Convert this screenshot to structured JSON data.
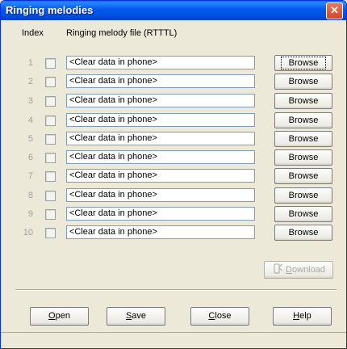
{
  "window": {
    "title": "Ringing melodies",
    "close_glyph": "✕"
  },
  "columns": {
    "index": "Index",
    "file": "Ringing melody file (RTTTL)"
  },
  "rows": [
    {
      "index": "1",
      "value": "<Clear data in phone>",
      "button": "Browse"
    },
    {
      "index": "2",
      "value": "<Clear data in phone>",
      "button": "Browse"
    },
    {
      "index": "3",
      "value": "<Clear data in phone>",
      "button": "Browse"
    },
    {
      "index": "4",
      "value": "<Clear data in phone>",
      "button": "Browse"
    },
    {
      "index": "5",
      "value": "<Clear data in phone>",
      "button": "Browse"
    },
    {
      "index": "6",
      "value": "<Clear data in phone>",
      "button": "Browse"
    },
    {
      "index": "7",
      "value": "<Clear data in phone>",
      "button": "Browse"
    },
    {
      "index": "8",
      "value": "<Clear data in phone>",
      "button": "Browse"
    },
    {
      "index": "9",
      "value": "<Clear data in phone>",
      "button": "Browse"
    },
    {
      "index": "10",
      "value": "<Clear data in phone>",
      "button": "Browse"
    }
  ],
  "download": {
    "icon": "phone-download-icon",
    "first": "D",
    "rest": "ownload"
  },
  "buttons": {
    "open": {
      "first": "O",
      "rest": "pen"
    },
    "save": {
      "first": "S",
      "rest": "ave"
    },
    "close": {
      "first": "C",
      "rest": "lose"
    },
    "help": {
      "first": "H",
      "rest": "elp"
    }
  },
  "colors": {
    "titlebar": "#0058ee",
    "face": "#ece9d8",
    "disabled_text": "#a7a69b"
  }
}
